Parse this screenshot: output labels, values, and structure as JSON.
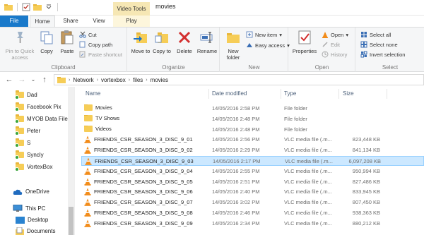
{
  "window": {
    "title": "movies",
    "context_tab": "Video Tools"
  },
  "tabs": [
    "File",
    "Home",
    "Share",
    "View",
    "Play"
  ],
  "ribbon": {
    "clipboard": {
      "label": "Clipboard",
      "pin": "Pin to Quick access",
      "copy": "Copy",
      "paste": "Paste",
      "cut": "Cut",
      "copy_path": "Copy path",
      "paste_shortcut": "Paste shortcut"
    },
    "organize": {
      "label": "Organize",
      "move_to": "Move to",
      "copy_to": "Copy to",
      "delete": "Delete",
      "rename": "Rename"
    },
    "new": {
      "label": "New",
      "new_folder": "New folder",
      "new_item": "New item",
      "easy_access": "Easy access"
    },
    "open": {
      "label": "Open",
      "properties": "Properties",
      "open": "Open",
      "edit": "Edit",
      "history": "History"
    },
    "select": {
      "label": "Select",
      "select_all": "Select all",
      "select_none": "Select none",
      "invert": "Invert selection"
    }
  },
  "address": {
    "breadcrumbs": [
      "Network",
      "vortexbox",
      "files",
      "movies"
    ]
  },
  "nav_pane": {
    "items": [
      {
        "label": "Dad",
        "icon": "folder-icon"
      },
      {
        "label": "Facebook Pix",
        "icon": "folder-icon"
      },
      {
        "label": "MYOB Data File",
        "icon": "folder-icon"
      },
      {
        "label": "Peter",
        "icon": "folder-icon"
      },
      {
        "label": "S",
        "icon": "folder-icon"
      },
      {
        "label": "Syncly",
        "icon": "folder-icon"
      },
      {
        "label": "VortexBox",
        "icon": "folder-icon"
      },
      {
        "label": "OneDrive",
        "icon": "cloud-icon"
      },
      {
        "label": "This PC",
        "icon": "computer-icon"
      },
      {
        "label": "Desktop",
        "icon": "desktop-icon"
      },
      {
        "label": "Documents",
        "icon": "documents-icon"
      }
    ]
  },
  "columns": {
    "name": "Name",
    "date": "Date modified",
    "type": "Type",
    "size": "Size"
  },
  "files": [
    {
      "name": "Movies",
      "date": "14/05/2016 2:58 PM",
      "type": "File folder",
      "size": "",
      "kind": "folder"
    },
    {
      "name": "TV Shows",
      "date": "14/05/2016 2:48 PM",
      "type": "File folder",
      "size": "",
      "kind": "folder"
    },
    {
      "name": "Videos",
      "date": "14/05/2016 2:48 PM",
      "type": "File folder",
      "size": "",
      "kind": "folder"
    },
    {
      "name": "FRIENDS_CSR_SEASON_3_DISC_9_01",
      "date": "14/05/2016 2:56 PM",
      "type": "VLC media file (.m...",
      "size": "823,448 KB",
      "kind": "vlc"
    },
    {
      "name": "FRIENDS_CSR_SEASON_3_DISC_9_02",
      "date": "14/05/2016 2:29 PM",
      "type": "VLC media file (.m...",
      "size": "841,134 KB",
      "kind": "vlc"
    },
    {
      "name": "FRIENDS_CSR_SEASON_3_DISC_9_03",
      "date": "14/05/2016 2:17 PM",
      "type": "VLC media file (.m...",
      "size": "6,097,208 KB",
      "kind": "vlc",
      "selected": true
    },
    {
      "name": "FRIENDS_CSR_SEASON_3_DISC_9_04",
      "date": "14/05/2016 2:55 PM",
      "type": "VLC media file (.m...",
      "size": "950,994 KB",
      "kind": "vlc"
    },
    {
      "name": "FRIENDS_CSR_SEASON_3_DISC_9_05",
      "date": "14/05/2016 2:51 PM",
      "type": "VLC media file (.m...",
      "size": "827,486 KB",
      "kind": "vlc"
    },
    {
      "name": "FRIENDS_CSR_SEASON_3_DISC_9_06",
      "date": "14/05/2016 2:40 PM",
      "type": "VLC media file (.m...",
      "size": "833,945 KB",
      "kind": "vlc"
    },
    {
      "name": "FRIENDS_CSR_SEASON_3_DISC_9_07",
      "date": "14/05/2016 3:02 PM",
      "type": "VLC media file (.m...",
      "size": "807,450 KB",
      "kind": "vlc"
    },
    {
      "name": "FRIENDS_CSR_SEASON_3_DISC_9_08",
      "date": "14/05/2016 2:46 PM",
      "type": "VLC media file (.m...",
      "size": "938,363 KB",
      "kind": "vlc"
    },
    {
      "name": "FRIENDS_CSR_SEASON_3_DISC_9_09",
      "date": "14/05/2016 2:34 PM",
      "type": "VLC media file (.m...",
      "size": "880,212 KB",
      "kind": "vlc"
    }
  ],
  "colors": {
    "file_tab": "#1979ca",
    "selection": "#cce8ff",
    "context_tab": "#f6e7b4",
    "folder": "#f6cd57",
    "vlc_cone": "#f28c1a",
    "delete_red": "#d32f2f"
  }
}
